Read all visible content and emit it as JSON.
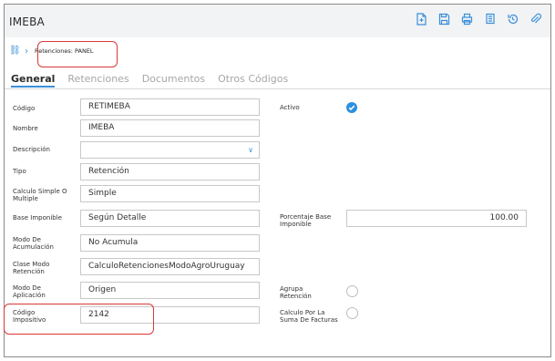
{
  "header": {
    "title": "IMEBA",
    "toolbar": [
      {
        "icon": "new-document-icon"
      },
      {
        "icon": "save-icon"
      },
      {
        "icon": "print-icon"
      },
      {
        "icon": "copy-icon"
      },
      {
        "icon": "history-icon"
      },
      {
        "icon": "attach-icon"
      }
    ]
  },
  "breadcrumb": {
    "icon": "link-icon",
    "separator": "›",
    "current": "Retenciones: PANEL"
  },
  "tabs": [
    {
      "label": "General",
      "active": true
    },
    {
      "label": "Retenciones",
      "active": false
    },
    {
      "label": "Documentos",
      "active": false
    },
    {
      "label": "Otros Códigos",
      "active": false
    }
  ],
  "fields": {
    "codigo": {
      "label": "Código",
      "value": "RETIMEBA"
    },
    "nombre": {
      "label": "Nombre",
      "value": "IMEBA"
    },
    "descripcion": {
      "label": "Descripción",
      "value": ""
    },
    "tipo": {
      "label": "Tipo",
      "value": "Retención"
    },
    "calculo_simple": {
      "label": "Calculo Simple O Multiple",
      "value": "Simple"
    },
    "base_imponible": {
      "label": "Base Imponible",
      "value": "Según Detalle"
    },
    "modo_acumulacion": {
      "label": "Modo De Acumulación",
      "value": "No Acumula"
    },
    "clase_modo": {
      "label": "Clase Modo Retención",
      "value": "CalculoRetencionesModoAgroUruguay"
    },
    "modo_aplicacion": {
      "label": "Modo De Aplicación",
      "value": "Origen"
    },
    "codigo_impositivo": {
      "label": "Código Impositivo",
      "value": "2142"
    },
    "activo": {
      "label": "Activo",
      "checked": true
    },
    "porcentaje_base": {
      "label": "Porcentaje Base Imponible",
      "value": "100.00"
    },
    "agrupa_retencion": {
      "label": "Agrupa Retención",
      "checked": false
    },
    "calculo_suma": {
      "label": "Calculo Por La Suma De Facturas",
      "checked": false
    }
  },
  "colors": {
    "accent": "#3b8fd9",
    "highlight": "#d93838"
  }
}
